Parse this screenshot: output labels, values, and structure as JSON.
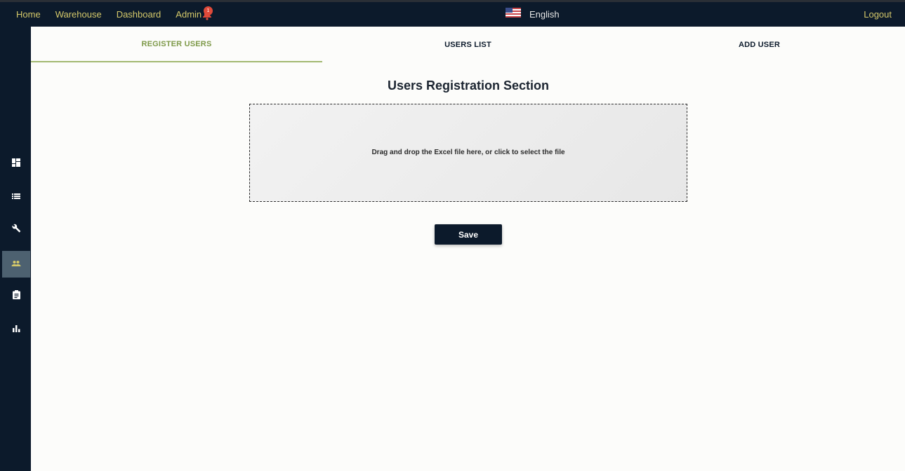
{
  "topbar": {
    "nav": [
      "Home",
      "Warehouse",
      "Dashboard",
      "Admin"
    ],
    "notification_count": "1",
    "language": "English",
    "logout": "Logout"
  },
  "sidebar": {
    "items": [
      {
        "icon": "dashboard-icon",
        "active": false
      },
      {
        "icon": "list-icon",
        "active": false
      },
      {
        "icon": "wrench-icon",
        "active": false
      },
      {
        "icon": "users-icon",
        "active": true
      },
      {
        "icon": "clipboard-icon",
        "active": false
      },
      {
        "icon": "bar-chart-icon",
        "active": false
      }
    ]
  },
  "tabs": [
    "REGISTER USERS",
    "USERS LIST",
    "ADD USER"
  ],
  "main": {
    "title": "Users Registration Section",
    "dropzone_text": "Drag and drop the Excel file here, or click to select the file",
    "save_label": "Save"
  },
  "colors": {
    "navbar": "#0c1a2b",
    "accent_yellow": "#d5c96a",
    "active_tab": "#7f9a4a",
    "badge": "#e04a3a"
  }
}
